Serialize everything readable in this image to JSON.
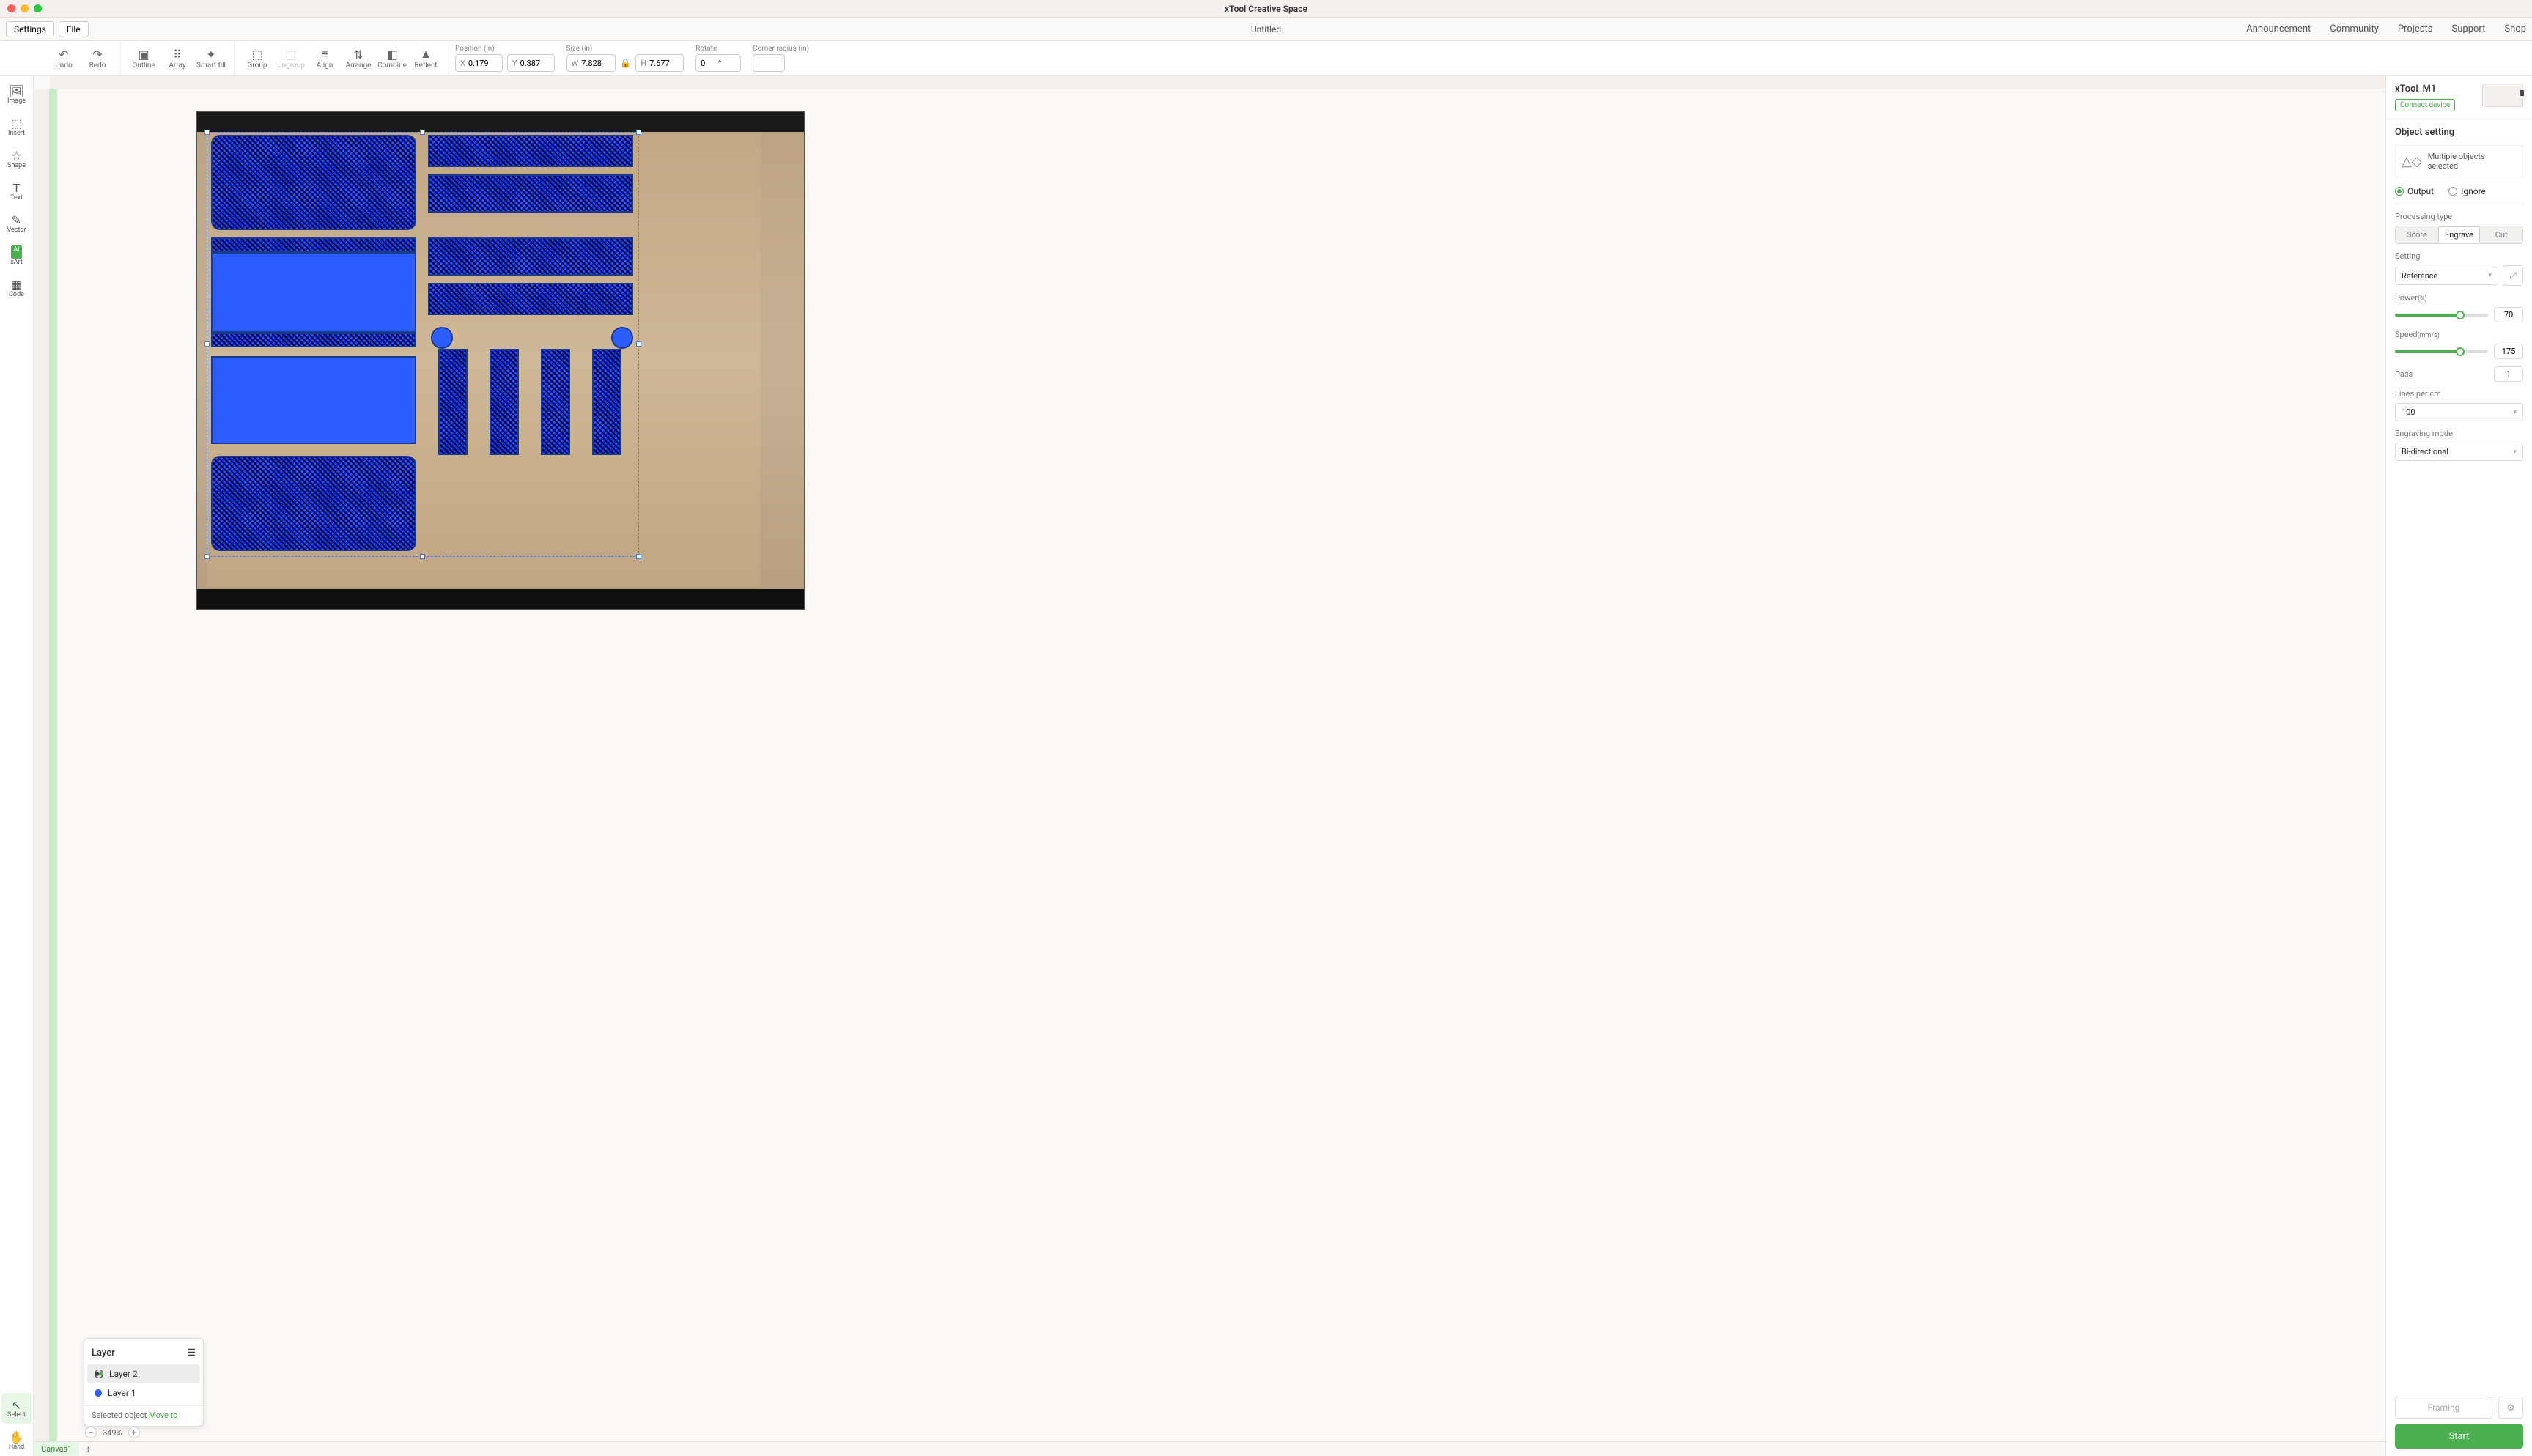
{
  "window_title": "xTool Creative Space",
  "menu": {
    "settings": "Settings",
    "file": "File",
    "doc": "Untitled",
    "links": [
      "Announcement",
      "Community",
      "Projects",
      "Support",
      "Shop"
    ]
  },
  "tools": {
    "undo": "Undo",
    "redo": "Redo",
    "outline": "Outline",
    "array": "Array",
    "smartfill": "Smart fill",
    "group": "Group",
    "ungroup": "Ungroup",
    "align": "Align",
    "arrange": "Arrange",
    "combine": "Combine",
    "reflect": "Reflect"
  },
  "props": {
    "position_label": "Position (in)",
    "x_prefix": "X",
    "x": "0.179",
    "y_prefix": "Y",
    "y": "0.387",
    "size_label": "Size (in)",
    "w_prefix": "W",
    "w": "7.828",
    "h_prefix": "H",
    "h": "7.677",
    "rotate_label": "Rotate",
    "rotate": "0",
    "deg": "°",
    "corner_label": "Corner radius (in)",
    "corner": ""
  },
  "left": {
    "image": "Image",
    "insert": "Insert",
    "shape": "Shape",
    "text": "Text",
    "vector": "Vector",
    "xart": "xArt",
    "code": "Code",
    "select": "Select",
    "hand": "Hand"
  },
  "layers": {
    "title": "Layer",
    "items": [
      {
        "name": "Layer 2",
        "color": "#1a1a1a",
        "sel": true
      },
      {
        "name": "Layer 1",
        "color": "#2b5dff",
        "sel": false
      }
    ],
    "selobj": "Selected object",
    "moveto": "Move to"
  },
  "zoom": "349%",
  "canvas_tab": "Canvas1",
  "right": {
    "device_name": "xTool_M1",
    "connect": "Connect device",
    "object_setting": "Object setting",
    "multi": "Multiple objects selected",
    "output": "Output",
    "ignore": "Ignore",
    "proc_label": "Processing type",
    "score": "Score",
    "engrave": "Engrave",
    "cut": "Cut",
    "setting_label": "Setting",
    "setting_val": "Reference",
    "power_label": "Power",
    "power_unit": "(%)",
    "power": "70",
    "speed_label": "Speed",
    "speed_unit": "(mm/s)",
    "speed": "175",
    "pass_label": "Pass",
    "pass": "1",
    "lines_label": "Lines per cm",
    "lines": "100",
    "engmode_label": "Engraving mode",
    "engmode": "Bi-directional",
    "framing": "Framing",
    "start": "Start"
  }
}
